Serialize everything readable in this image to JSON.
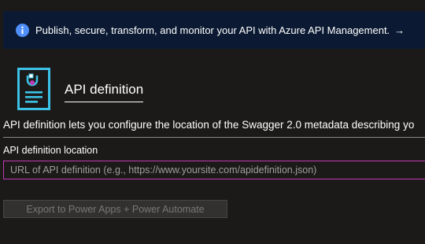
{
  "banner": {
    "text": "Publish, secure, transform, and monitor your API with Azure API Management.",
    "info_icon": "info-circle-icon",
    "arrow_icon": "arrow-right-icon",
    "arrow_glyph": "→",
    "background_color": "#0b1a32",
    "icon_color": "#4f8ff7"
  },
  "header": {
    "icon": "api-definition-document-icon",
    "icon_color": "#3bc2e6",
    "title": "API definition"
  },
  "description": "API definition lets you configure the location of the Swagger 2.0 metadata describing yo",
  "form": {
    "location_label": "API definition location",
    "url_input": {
      "value": "",
      "placeholder": "URL of API definition (e.g., https://www.yoursite.com/apidefinition.json)",
      "border_color": "#c239b3"
    }
  },
  "actions": {
    "export_label": "Export to Power Apps + Power Automate",
    "export_disabled": true
  }
}
